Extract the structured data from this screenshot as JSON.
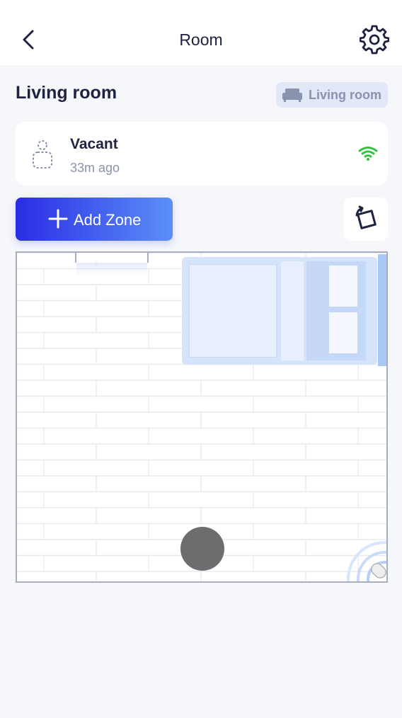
{
  "header": {
    "title": "Room"
  },
  "room": {
    "name": "Living room",
    "type_chip_label": "Living room"
  },
  "status": {
    "state": "Vacant",
    "time_ago": "33m ago",
    "signal_color": "#35c23f"
  },
  "actions": {
    "add_zone_label": "Add Zone"
  },
  "colors": {
    "accent_start": "#2a2de3",
    "accent_end": "#5b8ff7",
    "bed_fill": "#d5e3fb",
    "presence_dot": "#6d6d70"
  },
  "icons": {
    "back": "chevron-left-icon",
    "settings": "gear-icon",
    "room_type": "sofa-icon",
    "person": "person-outline-icon",
    "signal": "wifi-icon",
    "add": "plus-icon",
    "rotate": "rotate-icon",
    "sensor": "radar-sensor-icon"
  }
}
